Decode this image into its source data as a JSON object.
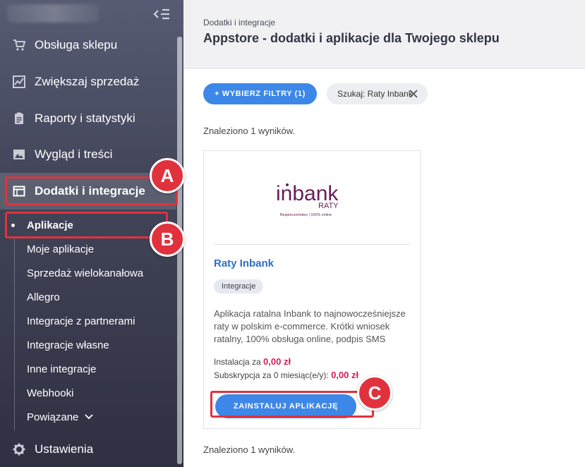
{
  "sidebar": {
    "items": [
      {
        "label": "Obsługa sklepu",
        "icon": "cart-icon"
      },
      {
        "label": "Zwiększaj sprzedaż",
        "icon": "chart-line-icon"
      },
      {
        "label": "Raporty i statystyki",
        "icon": "clipboard-icon"
      },
      {
        "label": "Wygląd i treści",
        "icon": "image-icon"
      },
      {
        "label": "Dodatki i integracje",
        "icon": "window-icon",
        "active": true
      }
    ],
    "subitems": [
      {
        "label": "Aplikacje",
        "active": true
      },
      {
        "label": "Moje aplikacje"
      },
      {
        "label": "Sprzedaż wielokanałowa"
      },
      {
        "label": "Allegro"
      },
      {
        "label": "Integracje z partnerami"
      },
      {
        "label": "Integracje własne"
      },
      {
        "label": "Inne integracje"
      },
      {
        "label": "Webhooki"
      },
      {
        "label": "Powiązane"
      }
    ],
    "settings_label": "Ustawienia"
  },
  "header": {
    "breadcrumb": "Dodatki i integracje",
    "title": "Appstore - dodatki i aplikacje dla Twojego sklepu"
  },
  "filters": {
    "button_label": "+ WYBIERZ FILTRY (1)",
    "chip_label": "Szukaj: Raty Inbank"
  },
  "results": {
    "found_top": "Znaleziono 1 wyników.",
    "found_bottom": "Znaleziono 1 wyników."
  },
  "card": {
    "logo_text": "inbank",
    "logo_sub": "RATY",
    "logo_tagline": "Bezpieczeństwo | 100% online",
    "title": "Raty Inbank",
    "tag": "Integracje",
    "description": "Aplikacja ratalna Inbank to najnowocześniejsze raty w polskim e-commerce. Krótki wniosek ratalny, 100% obsługa online, podpis SMS",
    "install_prefix": "Instalacja za",
    "install_price": "0,00 zł",
    "sub_prefix": "Subskrypcja za 0 miesiąc(e/y):",
    "sub_price": "0,00 zł",
    "install_button": "ZAINSTALUJ APLIKACJĘ"
  },
  "annotations": {
    "a": "A",
    "b": "B",
    "c": "C"
  },
  "colors": {
    "accent": "#3d87e8",
    "price": "#d61d5c",
    "highlight": "#e0323d",
    "brand": "#7a1a5a"
  }
}
